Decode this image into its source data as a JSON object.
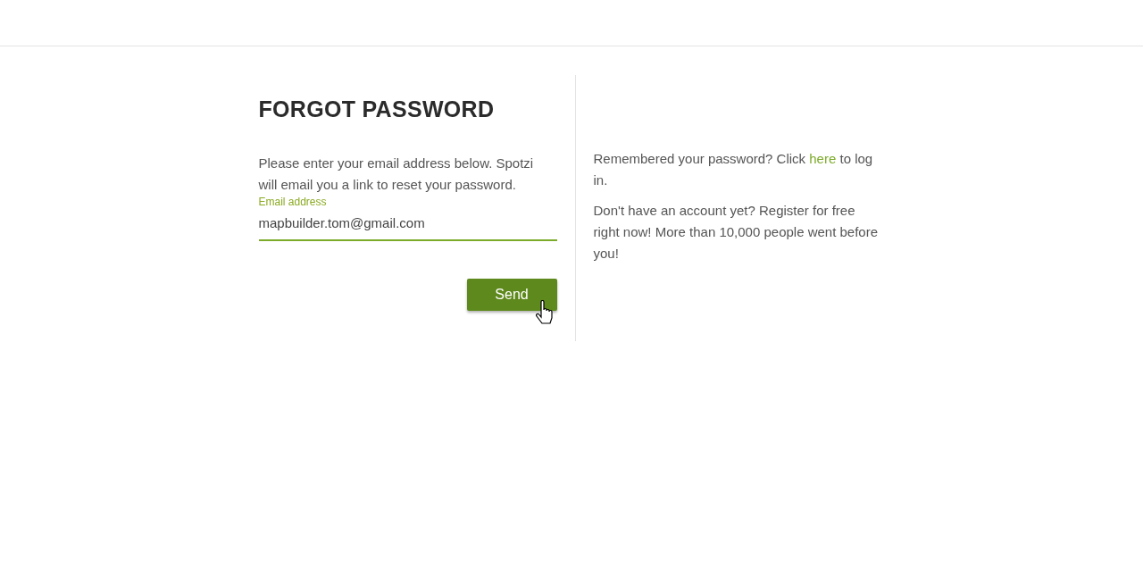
{
  "title": "FORGOT PASSWORD",
  "intro": "Please enter your email address below. Spotzi will email you a link to reset your password.",
  "email_field": {
    "label": "Email address",
    "value": "mapbuilder.tom@gmail.com",
    "focused": true
  },
  "send_button": {
    "label": "Send"
  },
  "login_note": {
    "before": "Remembered your password? Click ",
    "link": "here",
    "after": " to log in."
  },
  "register_note": "Don't have an account yet? Register for free right now! More than 10,000 people went before you!"
}
